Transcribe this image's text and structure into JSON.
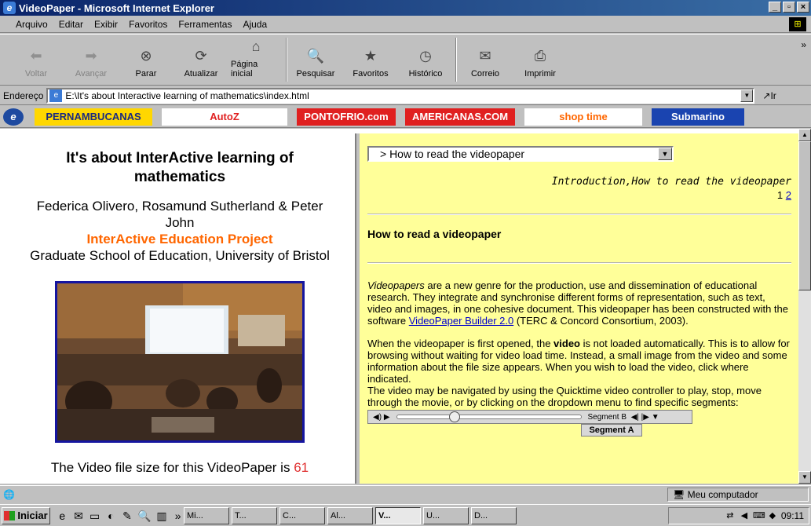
{
  "window": {
    "title": "VideoPaper - Microsoft Internet Explorer"
  },
  "menu": [
    "Arquivo",
    "Editar",
    "Exibir",
    "Favoritos",
    "Ferramentas",
    "Ajuda"
  ],
  "toolbar": {
    "back": "Voltar",
    "forward": "Avançar",
    "stop": "Parar",
    "refresh": "Atualizar",
    "home": "Página inicial",
    "search": "Pesquisar",
    "favorites": "Favoritos",
    "history": "Histórico",
    "mail": "Correio",
    "print": "Imprimir"
  },
  "address": {
    "label": "Endereço",
    "url": "E:\\It's about Interactive learning of mathematics\\index.html",
    "go": "Ir"
  },
  "links": [
    {
      "text": "PERNAMBUCANAS",
      "bg": "#ffd700",
      "color": "#1a2a80"
    },
    {
      "text": "AutoZ",
      "bg": "#ffffff",
      "color": "#e02020"
    },
    {
      "text": "PONTOFRIO.com",
      "bg": "#e02020",
      "color": "#ffffff"
    },
    {
      "text": "AMERICANAS.COM",
      "bg": "#e02020",
      "color": "#ffffff"
    },
    {
      "text": "shop time",
      "bg": "#ffffff",
      "color": "#ff6600"
    },
    {
      "text": "Submarino",
      "bg": "#1a44b0",
      "color": "#ffffff"
    }
  ],
  "left": {
    "title": "It's about InterActive learning of mathematics",
    "authors": "Federica Olivero, Rosamund Sutherland & Peter John",
    "project": "InterActive Education Project",
    "school": "Graduate School of Education, University of Bristol",
    "filesize_text": "The Video file size for this VideoPaper is",
    "filesize_num": "61"
  },
  "right": {
    "select_value": "> How to read the videopaper",
    "intro": "Introduction,How to read the videopaper",
    "page_current": "1",
    "page_link": "2",
    "section_title": "How to read a videopaper",
    "p1_em": "Videopapers",
    "p1_text": " are a new genre for the production, use and dissemination of educational research. They integrate and synchronise different forms of representation, such as text, video and images, in one cohesive document. This videopaper has been constructed with the software ",
    "p1_link": "VideoPaper Builder 2.0",
    "p1_tail": " (TERC & Concord Consortium, 2003).",
    "p2_a": "When the videopaper is first opened, the ",
    "p2_bold": "video",
    "p2_b": " is not loaded automatically. This is to allow for browsing without waiting for video load time. Instead, a small image from the video and some information about the file size appears. When you wish to load the video, click where indicated.",
    "p3": "The video may be navigated by using the Quicktime video controller to play, stop, move through the movie, or by clicking on the dropdown menu to find specific segments:",
    "qt_segment": "Segment B",
    "qt_segment_a": "Segment A"
  },
  "status": {
    "zone": "Meu computador"
  },
  "taskbar": {
    "start": "Iniciar",
    "items": [
      "Mi...",
      "T...",
      "C...",
      "Al...",
      "V...",
      "U...",
      "D..."
    ],
    "clock": "09:11"
  }
}
